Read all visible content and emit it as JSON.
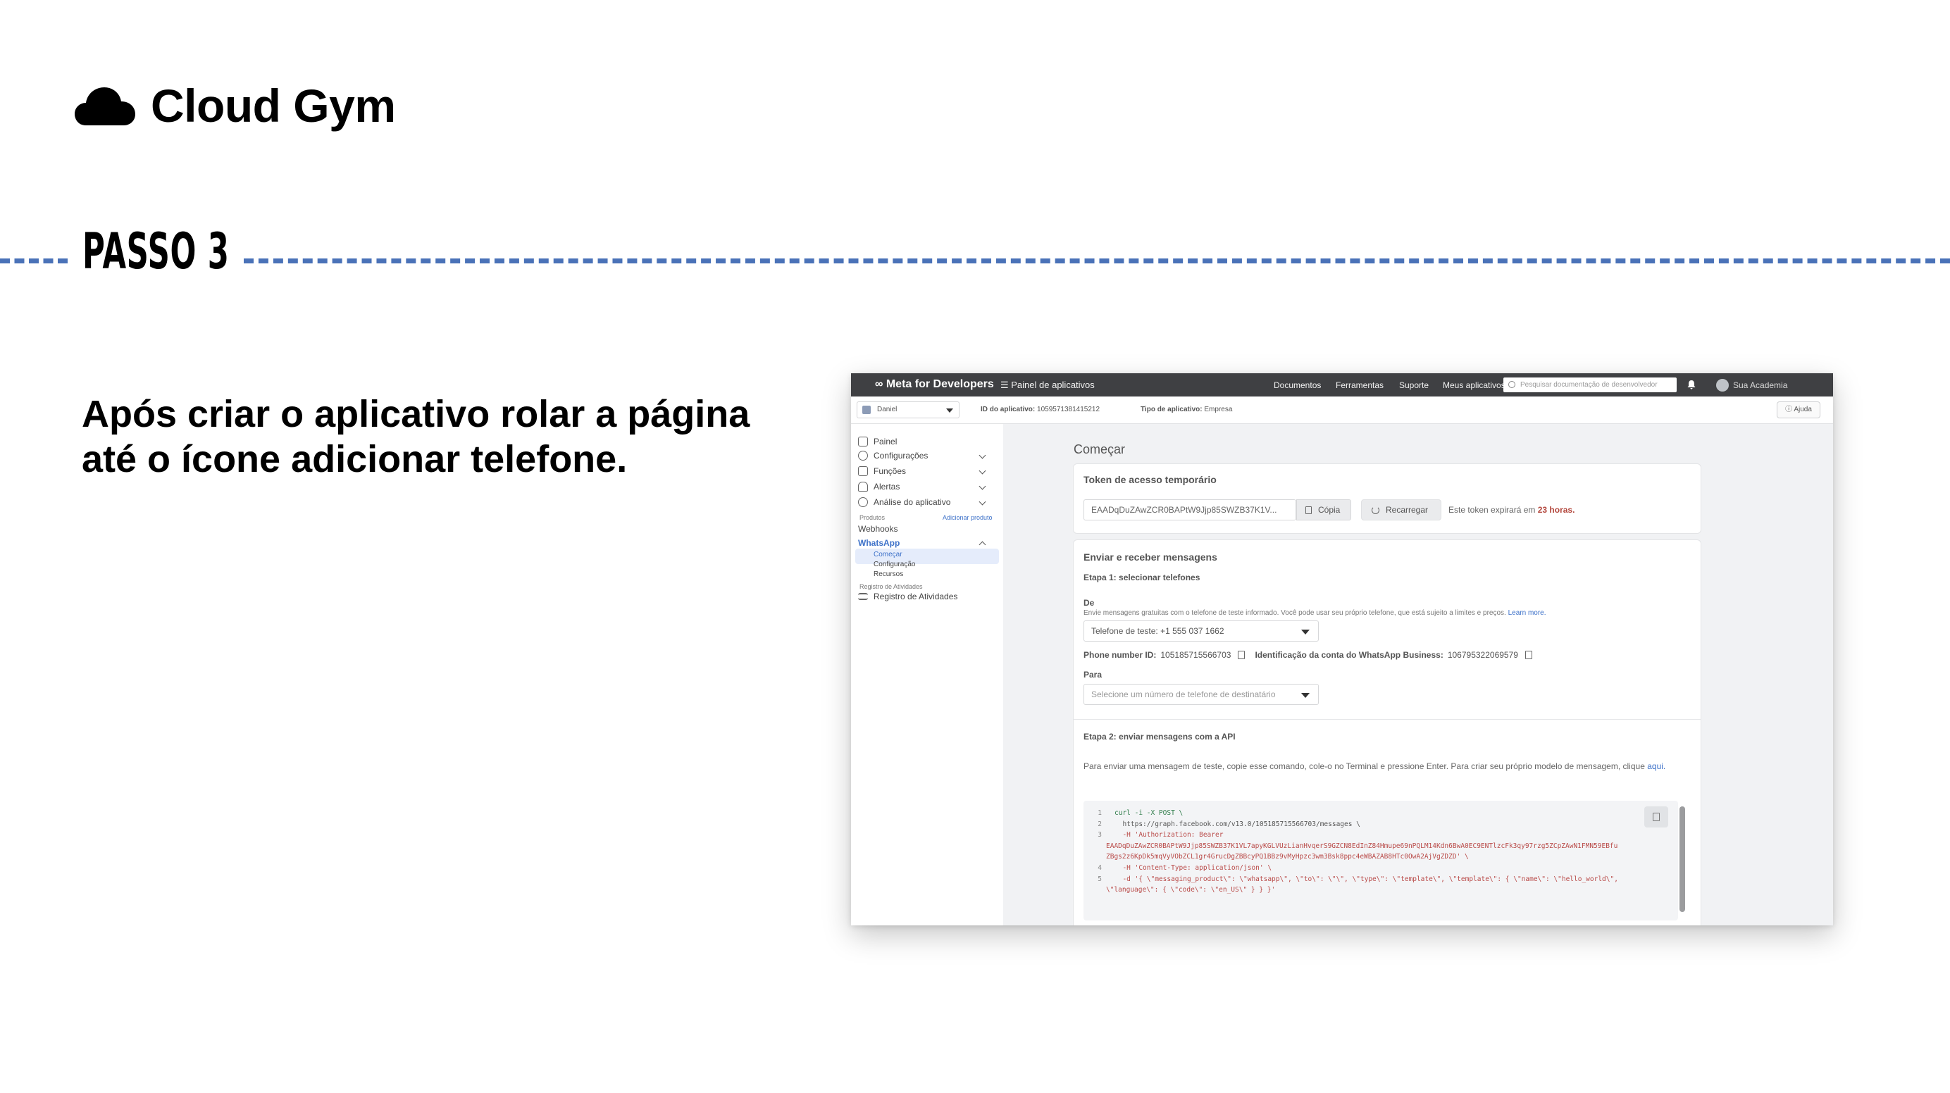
{
  "slide": {
    "brand": "Cloud Gym",
    "step": "PASSO 3",
    "instruction": "Após criar o aplicativo rolar a página até o ícone adicionar telefone."
  },
  "colors": {
    "dash": "#4a72b8",
    "link": "#3e72c9",
    "topbar": "#3f4043",
    "token_expire": "#b3473d"
  },
  "topbar": {
    "brand": "∞ Meta for Developers",
    "panel": "☰  Painel de aplicativos",
    "nav": [
      "Documentos",
      "Ferramentas",
      "Suporte",
      "Meus aplicativos"
    ],
    "search_placeholder": "Pesquisar documentação de desenvolvedor",
    "account": "Sua Academia"
  },
  "subbar": {
    "app_name": "Daniel",
    "app_id_label": "ID do aplicativo:",
    "app_id": "1059571381415212",
    "app_type_label": "Tipo de aplicativo:",
    "app_type": "Empresa",
    "help": "Ajuda"
  },
  "sidebar": {
    "items": [
      {
        "label": "Painel",
        "icon": "home-icon"
      },
      {
        "label": "Configurações",
        "icon": "gear-icon"
      },
      {
        "label": "Funções",
        "icon": "roles-icon"
      },
      {
        "label": "Alertas",
        "icon": "bell-icon"
      },
      {
        "label": "Análise do aplicativo",
        "icon": "check-shield-icon"
      }
    ],
    "products_label": "Produtos",
    "add_product": "Adicionar produto",
    "webhooks": "Webhooks",
    "whatsapp": "WhatsApp",
    "sub_items": [
      "Começar",
      "Configuração",
      "Recursos"
    ],
    "activity_header": "Registro de Atividades",
    "activity_item": "Registro de Atividades"
  },
  "main": {
    "title": "Começar",
    "token_card": {
      "title": "Token de acesso temporário",
      "token_value": "EAADqDuZAwZCR0BAPtW9Jjp85SWZB37K1V...",
      "copy": "Cópia",
      "reload": "Recarregar",
      "expire_text": "Este token expirará em",
      "expire_hours": "23 horas."
    },
    "send_card": {
      "title": "Enviar e receber mensagens",
      "step1": "Etapa 1: selecionar telefones",
      "from_label": "De",
      "from_help": "Envie mensagens gratuitas com o telefone de teste informado. Você pode usar seu próprio telefone, que está sujeito a limites e preços.",
      "learn_more": "Learn more.",
      "from_value": "Telefone de teste: +1 555 037 1662",
      "phone_id_label": "Phone number ID:",
      "phone_id": "105185715566703",
      "waba_label": "Identificação da conta do WhatsApp Business:",
      "waba_id": "106795322069579",
      "to_label": "Para",
      "to_placeholder": "Selecione um número de telefone de destinatário",
      "step2": "Etapa 2: enviar mensagens com a API",
      "step2_text": "Para enviar uma mensagem de teste, copie esse comando, cole-o no Terminal e pressione Enter. Para criar seu próprio modelo de mensagem, clique",
      "step2_link": "aqui."
    },
    "code": [
      {
        "n": "1",
        "text": "curl -i -X POST \\"
      },
      {
        "n": "2",
        "text": "  https://graph.facebook.com/v13.0/105185715566703/messages \\"
      },
      {
        "n": "3",
        "text": "  -H 'Authorization: Bearer"
      },
      {
        "n": "",
        "text": "EAADqDuZAwZCR0BAPtW9Jjp85SWZB37K1VL7apyKGLVUzLianHvqerS9GZCN8EdInZ84Hmupe69nPQLM14Kdn6BwA0EC9ENTlzcFk3qy97rzg5ZCpZAwN1FMN59EBfu"
      },
      {
        "n": "",
        "text": "ZBgs2z6KpDk5mqVyVObZCL1gr4GrucDgZBBcyPQ1BBz9vMyHpzc3wm3Bsk8ppc4eWBAZAB8HTc0OwA2AjVgZDZD' \\"
      },
      {
        "n": "4",
        "text": "  -H 'Content-Type: application/json' \\"
      },
      {
        "n": "5",
        "text": "  -d '{ \\\"messaging_product\\\": \\\"whatsapp\\\", \\\"to\\\": \\\"\\\", \\\"type\\\": \\\"template\\\", \\\"template\\\": { \\\"name\\\": \\\"hello_world\\\","
      },
      {
        "n": "",
        "text": "\\\"language\\\": { \\\"code\\\": \\\"en_US\\\" } } }'"
      }
    ]
  }
}
